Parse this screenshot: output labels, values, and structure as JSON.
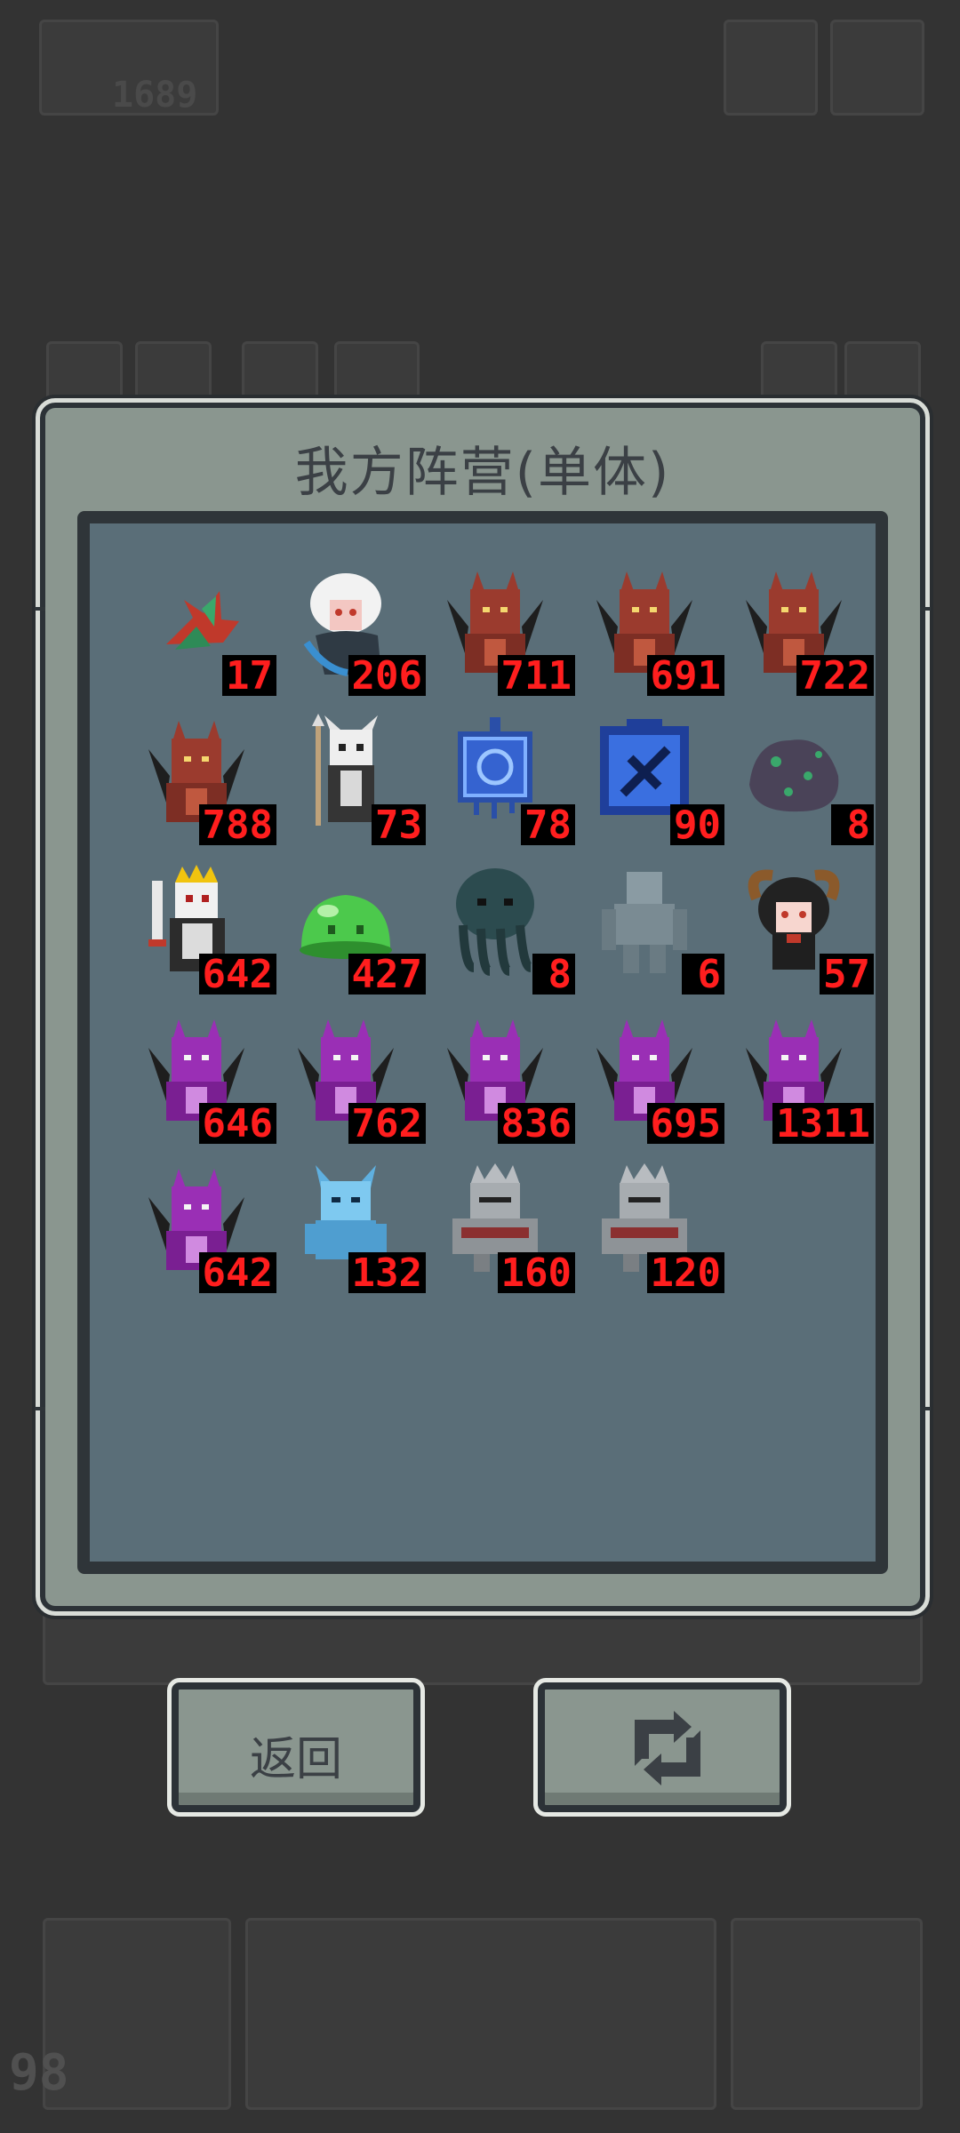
{
  "background": {
    "score": "1689",
    "level": "98"
  },
  "dialog": {
    "title": "我方阵营(单体)"
  },
  "units": [
    {
      "name": "crystal-flower",
      "count": "17"
    },
    {
      "name": "white-haired-sorceress",
      "count": "206"
    },
    {
      "name": "red-dragon",
      "count": "711"
    },
    {
      "name": "red-dragon",
      "count": "691"
    },
    {
      "name": "red-dragon",
      "count": "722"
    },
    {
      "name": "red-dragon",
      "count": "788"
    },
    {
      "name": "skeleton-lancer",
      "count": "73"
    },
    {
      "name": "blue-rune-cube",
      "count": "78"
    },
    {
      "name": "blue-rune-block",
      "count": "90"
    },
    {
      "name": "mossy-rock",
      "count": "8"
    },
    {
      "name": "skeleton-king",
      "count": "642"
    },
    {
      "name": "green-slime",
      "count": "427"
    },
    {
      "name": "cthulhu",
      "count": "8"
    },
    {
      "name": "stone-golem",
      "count": "6"
    },
    {
      "name": "horned-girl",
      "count": "57"
    },
    {
      "name": "purple-dragon",
      "count": "646"
    },
    {
      "name": "purple-dragon",
      "count": "762"
    },
    {
      "name": "purple-dragon",
      "count": "836"
    },
    {
      "name": "purple-dragon",
      "count": "695"
    },
    {
      "name": "purple-dragon",
      "count": "1311"
    },
    {
      "name": "purple-dragon",
      "count": "642"
    },
    {
      "name": "ice-demon",
      "count": "132"
    },
    {
      "name": "armored-knight",
      "count": "160"
    },
    {
      "name": "armored-knight",
      "count": "120"
    }
  ],
  "buttons": {
    "back_label": "返回",
    "refresh_icon": "refresh-icon"
  },
  "colors": {
    "count_text": "#ff1e1e",
    "red_dragon": "#9b3b2e",
    "purple_dragon": "#9a2fb5"
  }
}
